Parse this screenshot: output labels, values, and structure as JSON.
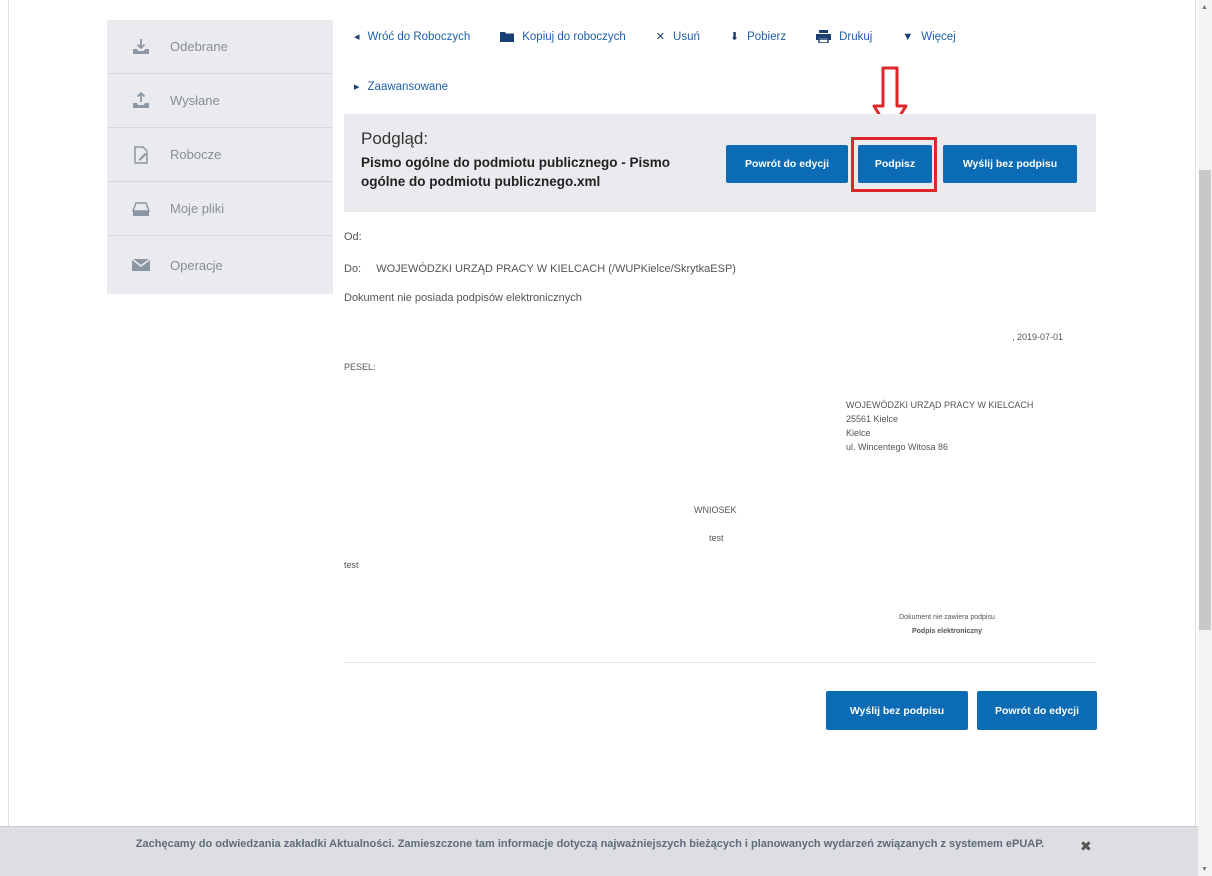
{
  "sidebar": {
    "items": [
      {
        "label": "Odebrane",
        "icon": "inbox-download-icon"
      },
      {
        "label": "Wysłane",
        "icon": "outbox-upload-icon"
      },
      {
        "label": "Robocze",
        "icon": "draft-document-icon"
      },
      {
        "label": "Moje pliki",
        "icon": "folder-tray-icon"
      },
      {
        "label": "Operacje",
        "icon": "envelope-icon"
      }
    ]
  },
  "toolbar": {
    "back": "Wróć do Roboczych",
    "copy": "Kopiuj do roboczych",
    "delete": "Usuń",
    "download": "Pobierz",
    "print": "Drukuj",
    "more": "Więcej",
    "advanced": "Zaawansowane"
  },
  "preview": {
    "title": "Podgląd:",
    "subtitle": "Pismo ogólne do podmiotu publicznego - Pismo ogólne do podmiotu publicznego.xml",
    "back_to_edit": "Powrót do edycji",
    "sign": "Podpisz",
    "send_unsigned": "Wyślij bez podpisu"
  },
  "message": {
    "from_label": "Od:",
    "to_label": "Do:",
    "to_value": "WOJEWÓDZKI URZĄD PRACY W KIELCACH (/WUPKielce/SkrytkaESP)",
    "signature_status": "Dokument nie posiada podpisów elektronicznych"
  },
  "document": {
    "date": ", 2019-07-01",
    "pesel_label": "PESEL:",
    "recipient": {
      "name": "WOJEWÓDZKI URZĄD PRACY W KIELCACH",
      "postal": "25561 Kielce",
      "city": "Kielce",
      "street": "ul. Wincentego Witosa 86"
    },
    "heading": "WNIOSEK",
    "subject": "test",
    "body": "test",
    "sig_note": "Dokument nie zawiera podpisu",
    "sig_type": "Podpis elektroniczny"
  },
  "bottom_buttons": {
    "send_unsigned": "Wyślij bez podpisu",
    "back_to_edit": "Powrót do edycji"
  },
  "banner": {
    "text": "Zachęcamy do odwiedzania zakładki Aktualności. Zamieszczone tam informacje dotyczą najważniejszych bieżących i planowanych wydarzeń związanych z systemem ePUAP."
  },
  "colors": {
    "primary_button": "#0b6cb5",
    "link": "#1f5fa9",
    "highlight": "#e0262d",
    "panel": "#e9ebee"
  }
}
